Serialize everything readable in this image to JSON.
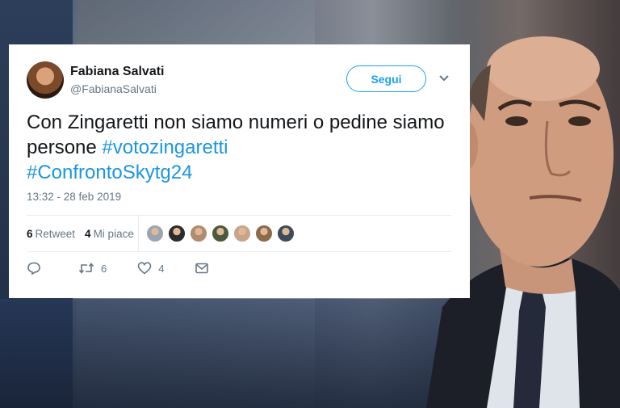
{
  "tweet": {
    "author_name": "Fabiana Salvati",
    "author_handle": "@FabianaSalvati",
    "follow_label": "Segui",
    "text_plain": "Con Zingaretti non siamo numeri o pedine siamo persone",
    "hashtag_1": "#votozingaretti",
    "hashtag_2": "#ConfrontoSkytg24",
    "timestamp": "13:32 - 28 feb 2019",
    "retweet_count": "6",
    "retweet_label": "Retweet",
    "like_count": "4",
    "like_label": "Mi piace",
    "action_retweet_count": "6",
    "action_like_count": "4"
  },
  "icons": {
    "reply": "reply-icon",
    "retweet": "retweet-icon",
    "like": "heart-icon",
    "message": "envelope-icon",
    "caret": "chevron-down-icon"
  },
  "colors": {
    "accent": "#1da1f2",
    "hashtag": "#1b95e0",
    "text": "#14171a",
    "muted": "#657786"
  },
  "liker_colors": [
    "#9aa5b1",
    "#2b2b2b",
    "#b08b6e",
    "#4a5a3a",
    "#c9a38a",
    "#8a6a4a",
    "#3d4a5a"
  ]
}
